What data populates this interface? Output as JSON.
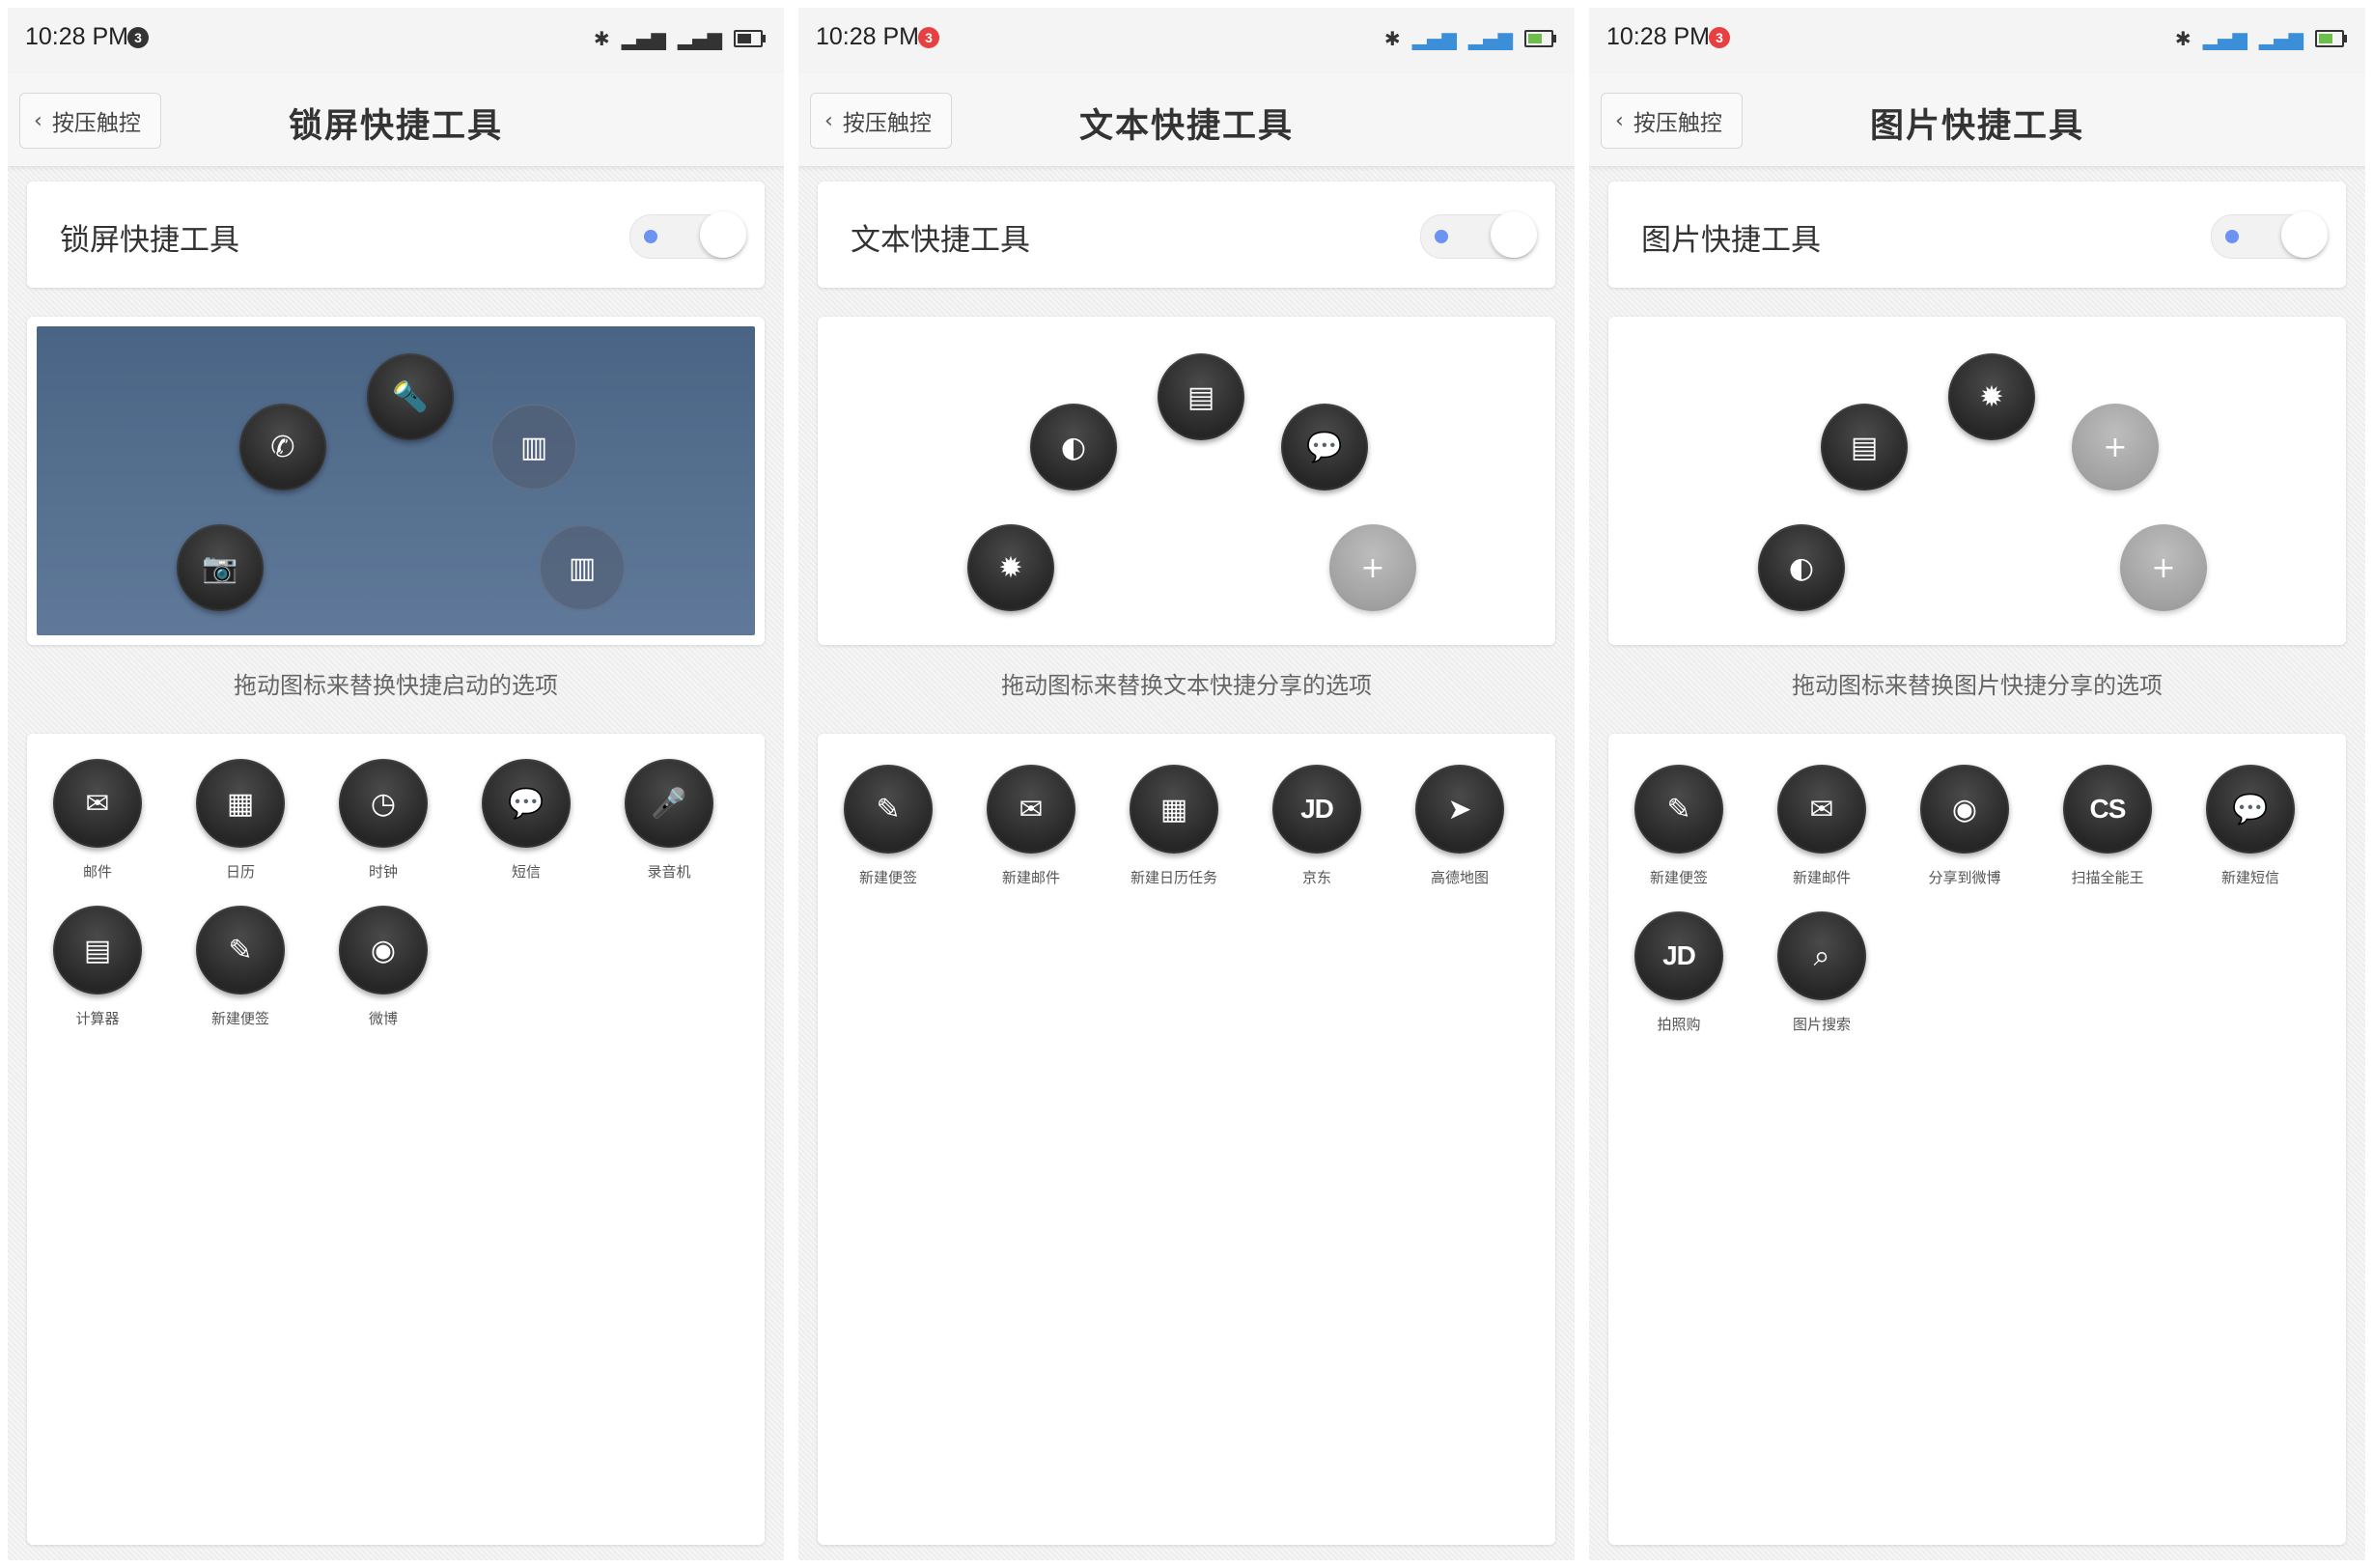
{
  "screens": [
    {
      "status": {
        "time": "10:28 PM",
        "badge": "3",
        "badge_color": "#333333"
      },
      "back_label": "按压触控",
      "title": "锁屏快捷工具",
      "toggle_label": "锁屏快捷工具",
      "toggle_on": false,
      "preview": [
        {
          "icon": "flashlight-icon",
          "glyph": "🔦",
          "faded": false
        },
        {
          "icon": "phone-icon",
          "glyph": "✆",
          "faded": false
        },
        {
          "icon": "scanner-icon",
          "glyph": "▥",
          "faded": true
        },
        {
          "icon": "camera-icon",
          "glyph": "📷",
          "faded": false
        },
        {
          "icon": "scanner-icon",
          "glyph": "▥",
          "faded": true
        }
      ],
      "hint": "拖动图标来替换快捷启动的选项",
      "apps": [
        {
          "label": "邮件",
          "icon": "mail-icon",
          "glyph": "✉"
        },
        {
          "label": "日历",
          "icon": "calendar-icon",
          "glyph": "▦"
        },
        {
          "label": "时钟",
          "icon": "clock-icon",
          "glyph": "◷"
        },
        {
          "label": "短信",
          "icon": "message-icon",
          "glyph": "💬"
        },
        {
          "label": "录音机",
          "icon": "microphone-icon",
          "glyph": "🎤"
        },
        {
          "label": "计算器",
          "icon": "calculator-icon",
          "glyph": "▤"
        },
        {
          "label": "新建便签",
          "icon": "note-edit-icon",
          "glyph": "✎"
        },
        {
          "label": "微博",
          "icon": "weibo-icon",
          "glyph": "◉"
        }
      ]
    },
    {
      "status": {
        "time": "10:28 PM",
        "badge": "3",
        "badge_color": "#e84040"
      },
      "back_label": "按压触控",
      "title": "文本快捷工具",
      "toggle_label": "文本快捷工具",
      "toggle_on": false,
      "preview": [
        {
          "icon": "translate-icon",
          "glyph": "▤",
          "faded": false
        },
        {
          "icon": "toggle-icon",
          "glyph": "◐",
          "faded": false
        },
        {
          "icon": "message-icon",
          "glyph": "💬",
          "faded": false
        },
        {
          "icon": "brightness-icon",
          "glyph": "✹",
          "faded": false
        },
        {
          "icon": "plus-icon",
          "glyph": "+",
          "plus": true
        }
      ],
      "hint": "拖动图标来替换文本快捷分享的选项",
      "apps": [
        {
          "label": "新建便签",
          "icon": "note-edit-icon",
          "glyph": "✎"
        },
        {
          "label": "新建邮件",
          "icon": "mail-icon",
          "glyph": "✉"
        },
        {
          "label": "新建日历任务",
          "icon": "calendar-icon",
          "glyph": "▦"
        },
        {
          "label": "京东",
          "icon": "jd-icon",
          "glyph": "JD",
          "txt": true
        },
        {
          "label": "高德地图",
          "icon": "map-arrow-icon",
          "glyph": "➤"
        }
      ]
    },
    {
      "status": {
        "time": "10:28 PM",
        "badge": "3",
        "badge_color": "#e84040"
      },
      "back_label": "按压触控",
      "title": "图片快捷工具",
      "toggle_label": "图片快捷工具",
      "toggle_on": false,
      "preview": [
        {
          "icon": "brightness-icon",
          "glyph": "✹",
          "faded": false
        },
        {
          "icon": "translate-icon",
          "glyph": "▤",
          "faded": false
        },
        {
          "icon": "plus-icon",
          "glyph": "+",
          "plus": true
        },
        {
          "icon": "toggle-icon",
          "glyph": "◐",
          "faded": false
        },
        {
          "icon": "plus-icon",
          "glyph": "+",
          "plus": true
        }
      ],
      "hint": "拖动图标来替换图片快捷分享的选项",
      "apps": [
        {
          "label": "新建便签",
          "icon": "note-edit-icon",
          "glyph": "✎"
        },
        {
          "label": "新建邮件",
          "icon": "mail-icon",
          "glyph": "✉"
        },
        {
          "label": "分享到微博",
          "icon": "weibo-icon",
          "glyph": "◉"
        },
        {
          "label": "扫描全能王",
          "icon": "camscanner-icon",
          "glyph": "CS",
          "txt": true
        },
        {
          "label": "新建短信",
          "icon": "message-icon",
          "glyph": "💬"
        },
        {
          "label": "拍照购",
          "icon": "jd-icon",
          "glyph": "JD",
          "txt": true
        },
        {
          "label": "图片搜索",
          "icon": "image-search-icon",
          "glyph": "⌕"
        }
      ]
    }
  ]
}
